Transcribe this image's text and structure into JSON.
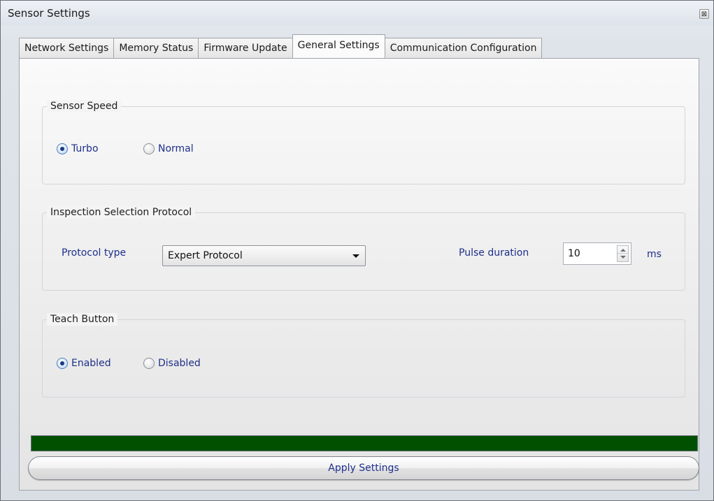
{
  "window": {
    "title": "Sensor Settings",
    "close_glyph": "⊠"
  },
  "tabs": [
    {
      "label": "Network Settings",
      "active": false
    },
    {
      "label": "Memory Status",
      "active": false
    },
    {
      "label": "Firmware Update",
      "active": false
    },
    {
      "label": "General Settings",
      "active": true
    },
    {
      "label": "Communication Configuration",
      "active": false
    }
  ],
  "sensor_speed": {
    "group_label": "Sensor Speed",
    "options": [
      {
        "label": "Turbo",
        "selected": true
      },
      {
        "label": "Normal",
        "selected": false
      }
    ]
  },
  "inspection": {
    "group_label": "Inspection Selection Protocol",
    "protocol_label": "Protocol type",
    "protocol_value": "Expert Protocol",
    "pulse_label": "Pulse duration",
    "pulse_value": "10",
    "pulse_unit": "ms"
  },
  "teach_button": {
    "group_label": "Teach Button",
    "options": [
      {
        "label": "Enabled",
        "selected": true
      },
      {
        "label": "Disabled",
        "selected": false
      }
    ]
  },
  "progress": {
    "percent": 100,
    "color": "#005000"
  },
  "apply_button": {
    "label": "Apply Settings"
  }
}
